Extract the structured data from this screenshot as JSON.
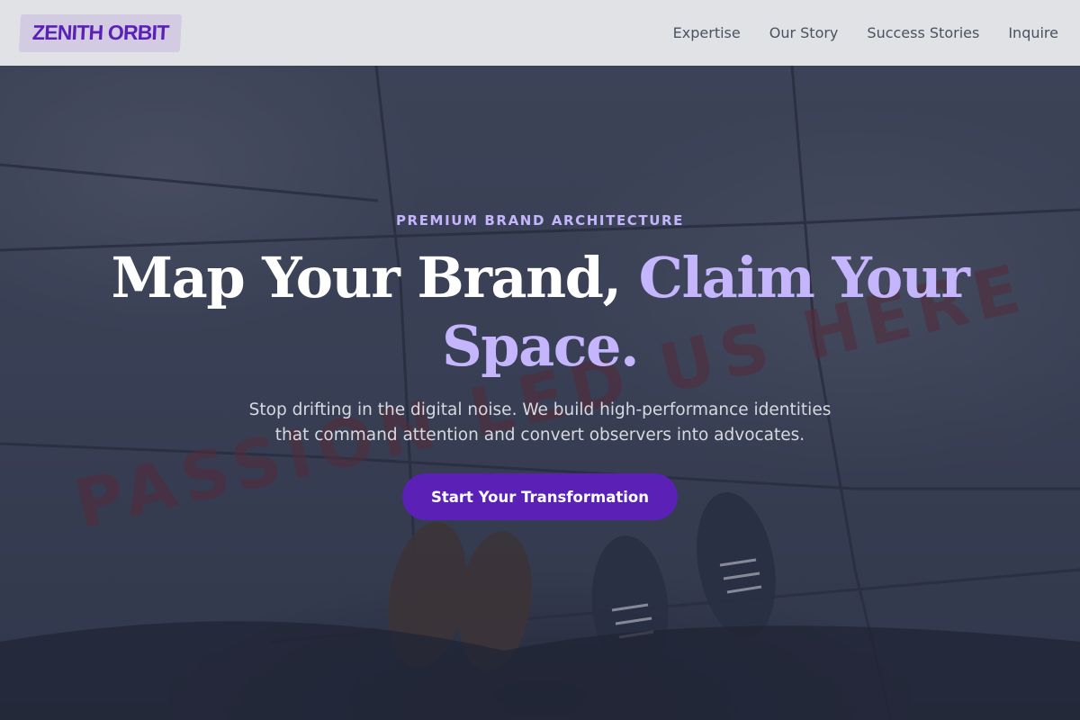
{
  "brand": {
    "name": "ZENITH ORBIT"
  },
  "nav": {
    "items": [
      {
        "label": "Expertise"
      },
      {
        "label": "Our Story"
      },
      {
        "label": "Success Stories"
      },
      {
        "label": "Inquire"
      }
    ]
  },
  "hero": {
    "eyebrow": "PREMIUM BRAND ARCHITECTURE",
    "headline_main": "Map Your Brand, ",
    "headline_accent": "Claim Your Space.",
    "subtext": "Stop drifting in the digital noise. We build high-performance identities that command attention and convert observers into advocates.",
    "cta_label": "Start Your Transformation",
    "background_text": "PASSION LED US HERE"
  },
  "colors": {
    "accent": "#5b21b6",
    "accent_light": "#c4b5fd",
    "header_bg": "#e1e2e5",
    "background_text": "#6b2f3a"
  }
}
